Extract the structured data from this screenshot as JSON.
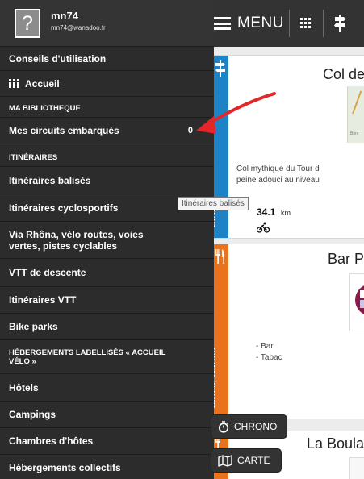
{
  "user": {
    "name": "mn74",
    "email": "mn74@wanadoo.fr",
    "avatar_glyph": "?"
  },
  "topbar": {
    "menu_label": "MENU",
    "icons": [
      "grid-icon",
      "signpost-icon"
    ]
  },
  "sidebar": {
    "conseils": "Conseils d'utilisation",
    "accueil": "Accueil",
    "section_bibliotheque": "MA BIBLIOTHEQUE",
    "mes_circuits": "Mes circuits embarqués",
    "mes_circuits_count": "0",
    "section_itineraires": "ITINÉRAIRES",
    "itineraires_balises": "Itinéraires balisés",
    "itineraires_cyclosportifs": "Itinéraires cyclosportifs",
    "via_rhona_line1": "Via Rhôna, vélo routes, voies",
    "via_rhona_line2": "vertes, pistes cyclables",
    "vtt_descente": "VTT de descente",
    "itineraires_vtt": "Itinéraires VTT",
    "bike_parks": "Bike parks",
    "section_hebergements_line1": "HÉBERGEMENTS LABELLISÉS « ACCUEIL",
    "section_hebergements_line2": "VÉLO »",
    "hotels": "Hôtels",
    "campings": "Campings",
    "chambres": "Chambres d'hôtes",
    "hebergements_collectifs": "Hébergements collectifs"
  },
  "tooltip": "Itinéraires balisés",
  "cards": [
    {
      "band_label": "Circuit",
      "band_color": "#1d82c6",
      "title": "Col de",
      "map_label": "Bon",
      "desc_line1": "Col mythique du Tour d",
      "desc_line2": "peine adouci au niveau",
      "distance": "34.1",
      "unit": "km"
    },
    {
      "band_label": "Cafés, Bars...",
      "band_color": "#e8721d",
      "title": "Bar P",
      "desc_line1": "- Bar",
      "desc_line2": "- Tabac"
    },
    {
      "band_label": "",
      "band_color": "#e8721d",
      "title": "La Boula"
    }
  ],
  "buttons": {
    "chrono": "CHRONO",
    "carte": "CARTE"
  },
  "colors": {
    "sidebar_bg": "#2c2c2c",
    "topbar_bg": "#333333",
    "circuit_blue": "#1d82c6",
    "cafe_orange": "#e8721d",
    "annotation_red": "#e3262a"
  }
}
